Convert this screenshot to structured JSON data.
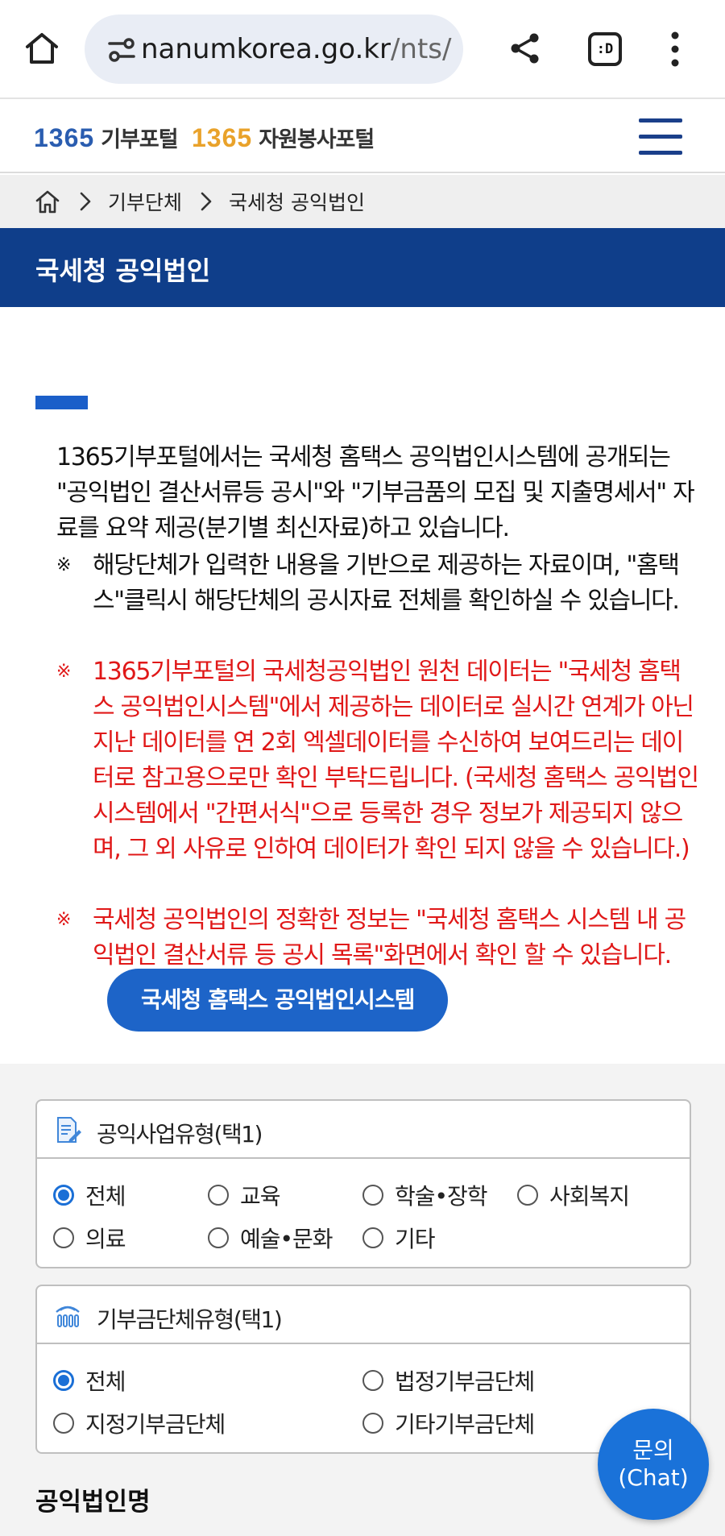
{
  "browser": {
    "url_host": "nanumkorea.go.kr",
    "url_path": "/nts/",
    "tabs_label": ":D"
  },
  "site": {
    "logo1_num": "1365",
    "logo1_text": "기부포털",
    "logo2_num": "1365",
    "logo2_text": "자원봉사포털"
  },
  "breadcrumb": {
    "items": [
      "기부단체",
      "국세청 공익법인"
    ]
  },
  "page_title": "국세청 공익법인",
  "intro": {
    "text": "1365기부포털에서는 국세청 홈택스 공익법인시스템에 공개되는 \"공익법인 결산서류등 공시\"와 \"기부금품의 모집 및 지출명세서\" 자료를 요약 제공(분기별 최신자료)하고 있습니다.",
    "mark": "※",
    "note1": "해당단체가 입력한 내용을 기반으로 제공하는 자료이며, \"홈택스\"클릭시 해당단체의 공시자료 전체를 확인하실 수 있습니다.",
    "note2": "1365기부포털의 국세청공익법인 원천 데이터는 \"국세청 홈택스 공익법인시스템\"에서 제공하는 데이터로 실시간 연계가 아닌 지난 데이터를 연 2회 엑셀데이터를 수신하여 보여드리는 데이터로 참고용으로만 확인 부탁드립니다. (국세청 홈택스 공익법인시스템에서 \"간편서식\"으로 등록한 경우 정보가 제공되지 않으며, 그 외 사유로 인하여 데이터가 확인 되지 않을 수 있습니다.)",
    "note3": "국세청 공익법인의 정확한 정보는 \"국세청 홈택스 시스템 내 공익법인 결산서류 등 공시 목록\"화면에서 확인 할 수 있습니다.",
    "hometax_button": "국세청 홈택스 공익법인시스템"
  },
  "filter_business_type": {
    "label": "공익사업유형(택1)",
    "options": [
      "전체",
      "교육",
      "학술•장학",
      "사회복지",
      "의료",
      "예술•문화",
      "기타"
    ],
    "selected": "전체"
  },
  "filter_org_type": {
    "label": "기부금단체유형(택1)",
    "options": [
      "전체",
      "법정기부금단체",
      "지정기부금단체",
      "기타기부금단체"
    ],
    "selected": "전체"
  },
  "org_name_label": "공익법인명",
  "chat": {
    "line1": "문의",
    "line2": "(Chat)"
  },
  "colors": {
    "brand_navy": "#0f3e8a",
    "accent_blue": "#1d64c8",
    "notice_red": "#e01818"
  }
}
